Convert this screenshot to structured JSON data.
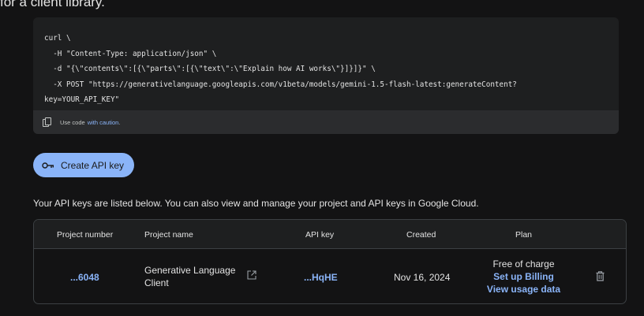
{
  "top_clip_text": "for a client library.",
  "code": {
    "lines": [
      "curl \\",
      "  -H \"Content-Type: application/json\" \\",
      "  -d \"{\\\"contents\\\":[{\\\"parts\\\":[{\\\"text\\\":\\\"Explain how AI works\\\"}]}]}\" \\",
      "  -X POST \"https://generativelanguage.googleapis.com/v1beta/models/gemini-1.5-flash-latest:generateContent?",
      "key=YOUR_API_KEY\""
    ],
    "footer_prefix": "Use code",
    "footer_link": "with caution",
    "footer_suffix": "."
  },
  "create_button": {
    "label": "Create API key"
  },
  "intro": {
    "text": "Your API keys are listed below. You can also view and manage your project and API keys in Google Cloud."
  },
  "table": {
    "headers": {
      "project_number": "Project number",
      "project_name": "Project name",
      "api_key": "API key",
      "created": "Created",
      "plan": "Plan"
    },
    "row": {
      "project_number": "...6048",
      "project_name_line1": "Generative Language",
      "project_name_line2": "Client",
      "api_key": "...HqHE",
      "created": "Nov 16, 2024",
      "plan_free": "Free of charge",
      "plan_billing": "Set up Billing",
      "plan_usage": "View usage data"
    }
  },
  "icons": {
    "copy": "copy-icon",
    "key": "key-icon",
    "open": "open-in-new-icon",
    "trash": "trash-icon"
  },
  "colors": {
    "background": "#131314",
    "card": "#1e1f20",
    "accent": "#8ab4f8"
  }
}
